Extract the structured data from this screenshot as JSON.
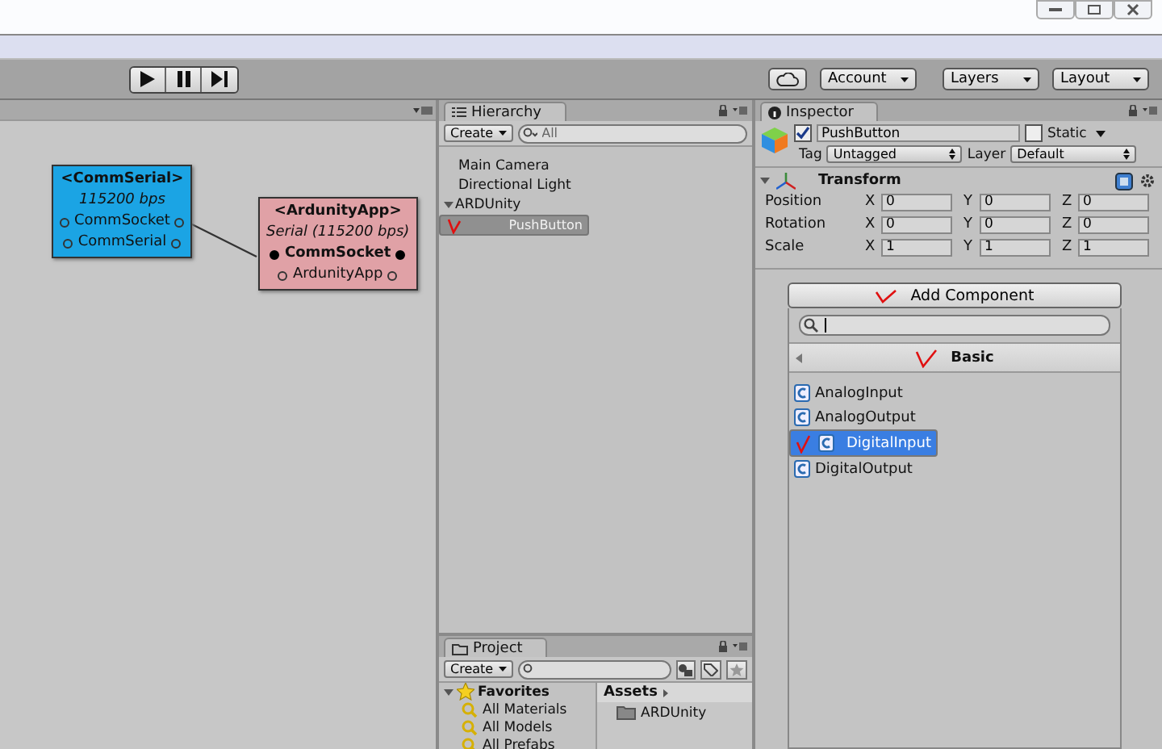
{
  "toolbar": {
    "menus": [
      "Account",
      "Layers",
      "Layout"
    ]
  },
  "graph": {
    "nodes": [
      {
        "title": "<CommSerial>",
        "subtitle": "115200 bps",
        "color": "#1ba4e4",
        "ports": [
          {
            "label": "CommSocket",
            "connected": false
          },
          {
            "label": "CommSerial",
            "connected": false
          }
        ]
      },
      {
        "title": "<ArdunityApp>",
        "subtitle": "Serial (115200 bps)",
        "color": "#e0a1a6",
        "ports": [
          {
            "label": "CommSocket",
            "connected": true
          },
          {
            "label": "ArdunityApp",
            "connected": false
          }
        ]
      }
    ]
  },
  "hierarchy": {
    "title": "Hierarchy",
    "create": "Create",
    "search_placeholder": "All",
    "items": [
      {
        "label": "Main Camera",
        "selected": false
      },
      {
        "label": "Directional Light",
        "selected": false
      },
      {
        "label": "ARDUnity",
        "selected": false,
        "expanded": true,
        "children": [
          {
            "label": "PushButton",
            "selected": true,
            "annotated": true
          }
        ]
      }
    ]
  },
  "project": {
    "title": "Project",
    "create": "Create",
    "favorites": {
      "label": "Favorites",
      "expanded": true,
      "items": [
        "All Materials",
        "All Models",
        "All Prefabs"
      ]
    },
    "assets": {
      "label": "Assets",
      "folders": [
        "ARDUnity"
      ]
    }
  },
  "inspector": {
    "title": "Inspector",
    "active": true,
    "name": "PushButton",
    "static": false,
    "static_label": "Static",
    "tag_label": "Tag",
    "tag": "Untagged",
    "layer_label": "Layer",
    "layer": "Default",
    "transform": {
      "title": "Transform",
      "expanded": true,
      "rows": [
        {
          "label": "Position",
          "fields": [
            {
              "axis": "X",
              "value": "0"
            },
            {
              "axis": "Y",
              "value": "0"
            },
            {
              "axis": "Z",
              "value": "0"
            }
          ]
        },
        {
          "label": "Rotation",
          "fields": [
            {
              "axis": "X",
              "value": "0"
            },
            {
              "axis": "Y",
              "value": "0"
            },
            {
              "axis": "Z",
              "value": "0"
            }
          ]
        },
        {
          "label": "Scale",
          "fields": [
            {
              "axis": "X",
              "value": "1"
            },
            {
              "axis": "Y",
              "value": "1"
            },
            {
              "axis": "Z",
              "value": "1"
            }
          ]
        }
      ]
    },
    "add_component": {
      "label": "Add Component",
      "annotated": true
    },
    "popup": {
      "category": "Basic",
      "category_annotated": true,
      "items": [
        {
          "label": "AnalogInput",
          "selected": false,
          "annotated": false
        },
        {
          "label": "AnalogOutput",
          "selected": false,
          "annotated": false
        },
        {
          "label": "DigitalInput",
          "selected": true,
          "annotated": true
        },
        {
          "label": "DigitalOutput",
          "selected": false,
          "annotated": false
        }
      ]
    }
  }
}
